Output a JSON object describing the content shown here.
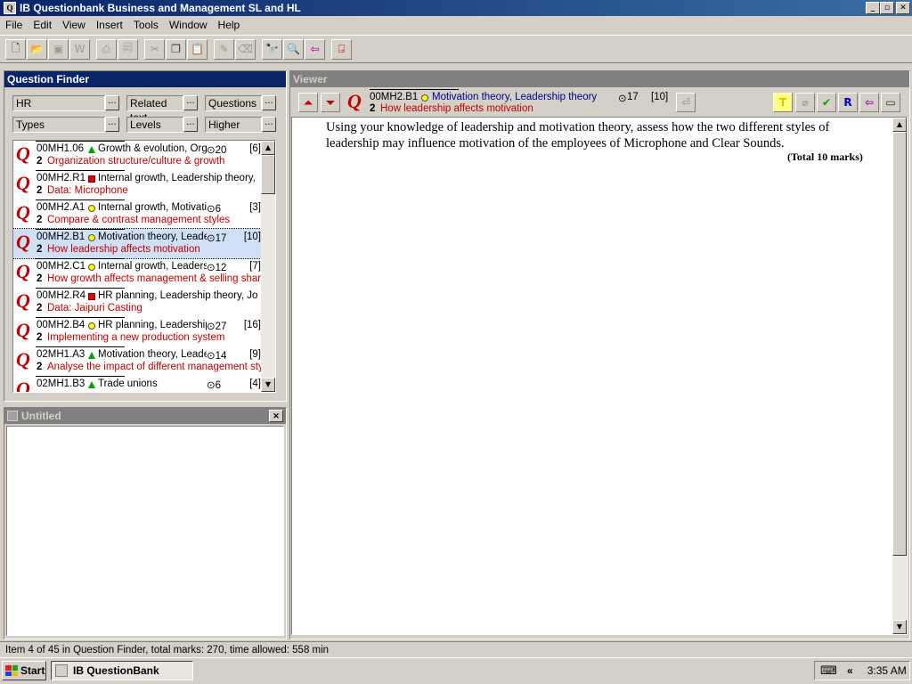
{
  "window": {
    "title": "IB Questionbank Business and Management SL and HL",
    "app_icon": "Q"
  },
  "menu": [
    "File",
    "Edit",
    "View",
    "Insert",
    "Tools",
    "Window",
    "Help"
  ],
  "finder": {
    "title": "Question Finder",
    "subject": "HR",
    "related": "Related text",
    "questions": "Questions",
    "types": "Types",
    "levels": "Levels",
    "level_value": "Higher",
    "more": "...",
    "items": [
      {
        "code": "00MH1.06",
        "shape": "tri",
        "topic": "Growth & evolution, Orga",
        "time": "20",
        "marks": "[6]",
        "level": "2",
        "sub": "Organization structure/culture & growth"
      },
      {
        "code": "00MH2.R1",
        "shape": "sq",
        "topic": "Internal growth, Leadership theory, Soc",
        "time": "",
        "marks": "",
        "level": "2",
        "sub": "Data: Microphone"
      },
      {
        "code": "00MH2.A1",
        "shape": "circ",
        "topic": "Internal growth, Motivatio",
        "time": "6",
        "marks": "[3]",
        "level": "2",
        "sub": "Compare & contrast management styles"
      },
      {
        "code": "00MH2.B1",
        "shape": "circ",
        "topic": "Motivation theory, Leader",
        "time": "17",
        "marks": "[10]",
        "level": "2",
        "sub": "How leadership affects motivation",
        "selected": true
      },
      {
        "code": "00MH2.C1",
        "shape": "circ",
        "topic": "Internal growth, Leadersh",
        "time": "12",
        "marks": "[7]",
        "level": "2",
        "sub": "How growth affects management & selling shares"
      },
      {
        "code": "00MH2.R4",
        "shape": "sq",
        "topic": "HR planning, Leadership theory, Job d",
        "time": "",
        "marks": "",
        "level": "2",
        "sub": "Data: Jaipuri Casting"
      },
      {
        "code": "00MH2.B4",
        "shape": "circ",
        "topic": "HR planning, Leadership",
        "time": "27",
        "marks": "[16]",
        "level": "2",
        "sub": "Implementing a new production system"
      },
      {
        "code": "02MH1.A3",
        "shape": "tri",
        "topic": "Motivation theory, Leader",
        "time": "14",
        "marks": "[9]",
        "level": "2",
        "sub": "Analyse the impact of different management styles"
      },
      {
        "code": "02MH1.B3",
        "shape": "tri",
        "topic": "Trade unions",
        "time": "6",
        "marks": "[4]",
        "level": "",
        "sub": ""
      }
    ]
  },
  "untitled": {
    "title": "Untitled",
    "close": "✕"
  },
  "viewer": {
    "title": "Viewer",
    "code": "00MH2.B1",
    "topic": "Motivation theory, Leadership theory",
    "time": "17",
    "marks": "[10]",
    "level": "2",
    "sub": "How leadership affects motivation",
    "body": "Using your knowledge of leadership and motivation theory, assess how the two different styles of leadership may influence motivation of the employees of Microphone and Clear Sounds.",
    "total": "(Total 10 marks)",
    "tools": {
      "t": "T",
      "r": "R"
    }
  },
  "status": "Item 4 of 45 in Question Finder, total marks: 270, time allowed: 558 min",
  "taskbar": {
    "start": "Start",
    "item": "IB QuestionBank",
    "clock": "3:35 AM",
    "tray_arrow": "«"
  },
  "colors": {
    "accent": "#0a246a",
    "red": "#c00000",
    "selected": "#cfe0f6"
  }
}
